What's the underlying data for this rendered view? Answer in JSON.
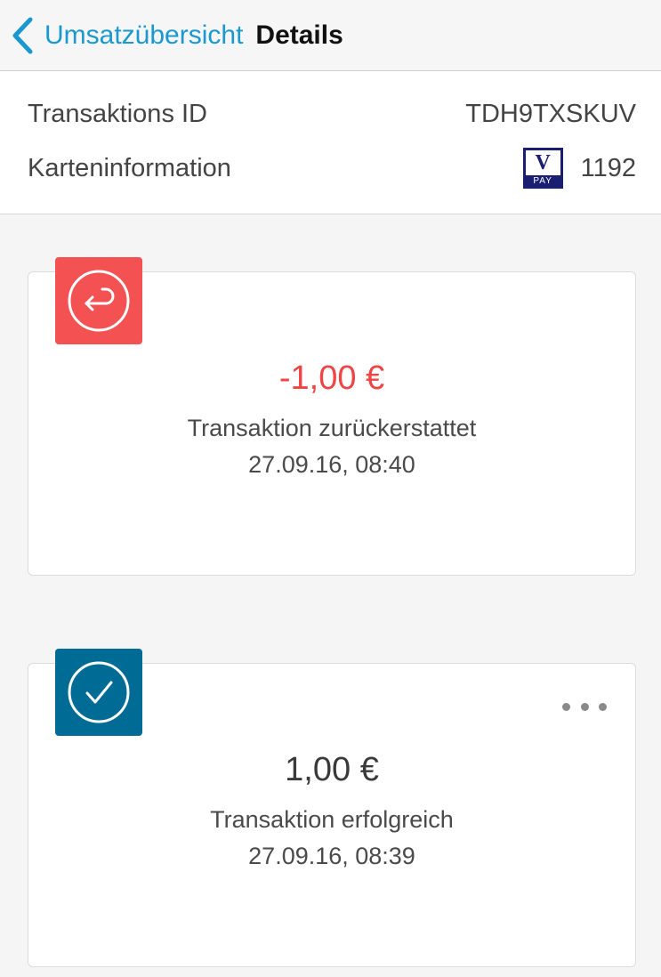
{
  "navbar": {
    "back_label": "Umsatzübersicht",
    "title": "Details"
  },
  "info": {
    "transaction_id_label": "Transaktions ID",
    "transaction_id_value": "TDH9TXSKUV",
    "card_label": "Karteninformation",
    "card_brand_top": "V",
    "card_brand_bottom": "PAY",
    "card_last_digits": "1192"
  },
  "transactions": [
    {
      "icon": "refund-icon",
      "amount": "-1,00 €",
      "status": "Transaktion zurückerstattet",
      "date": "27.09.16, 08:40",
      "color": "#f35152"
    },
    {
      "icon": "checkmark-icon",
      "amount": "1,00 €",
      "status": "Transaktion erfolgreich",
      "date": "27.09.16, 08:39",
      "color": "#006b94"
    }
  ],
  "colors": {
    "accent": "#1a98cf",
    "refund": "#f35152",
    "success": "#006b94"
  }
}
